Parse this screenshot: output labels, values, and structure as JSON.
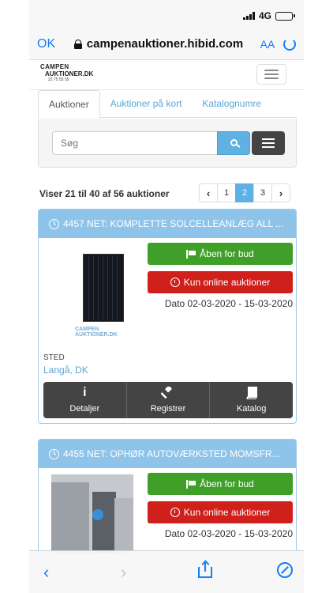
{
  "status_bar": {
    "network": "4G"
  },
  "browser": {
    "done_label": "OK",
    "url": "campenauktioner.hibid.com",
    "reader_label": "AA"
  },
  "site": {
    "logo_line1": "CAMPEN",
    "logo_line2": "AUKTIONER.DK",
    "logo_phone": "22 75 55 55"
  },
  "tabs": [
    {
      "label": "Auktioner",
      "active": true
    },
    {
      "label": "Auktioner på kort",
      "active": false
    },
    {
      "label": "Katalognumre",
      "active": false
    }
  ],
  "search": {
    "placeholder": "Søg"
  },
  "results": {
    "summary": "Viser 21 til 40 af 56 auktioner",
    "pages": [
      "1",
      "2",
      "3"
    ],
    "current_page": "2",
    "prev_icon": "chevron-left",
    "next_icon": "chevron-right"
  },
  "auctions": [
    {
      "title": "4457 NET: KOMPLETTE SOLCELLEANLÆG ALL ...",
      "bid_label": "Åben for bud",
      "online_label": "Kun online auktioner",
      "date": "Dato 02-03-2020 - 15-03-2020",
      "location_label": "STED",
      "location": "Langå, DK",
      "image_logo": "CAMPEN AUKTIONER.DK",
      "actions": [
        {
          "label": "Detaljer",
          "icon": "info-icon"
        },
        {
          "label": "Registrer",
          "icon": "gavel-icon"
        },
        {
          "label": "Katalog",
          "icon": "book-icon"
        }
      ]
    },
    {
      "title": "4455 NET: OPHØR AUTOVÆRKSTED MOMSFR...",
      "bid_label": "Åben for bud",
      "online_label": "Kun online auktioner",
      "date": "Dato 02-03-2020 - 15-03-2020"
    }
  ],
  "colors": {
    "accent": "#5fb0e3",
    "card_header": "#8fc4ea",
    "open_green": "#3f9f28",
    "online_red": "#d0201b",
    "ios_blue": "#147efb"
  }
}
